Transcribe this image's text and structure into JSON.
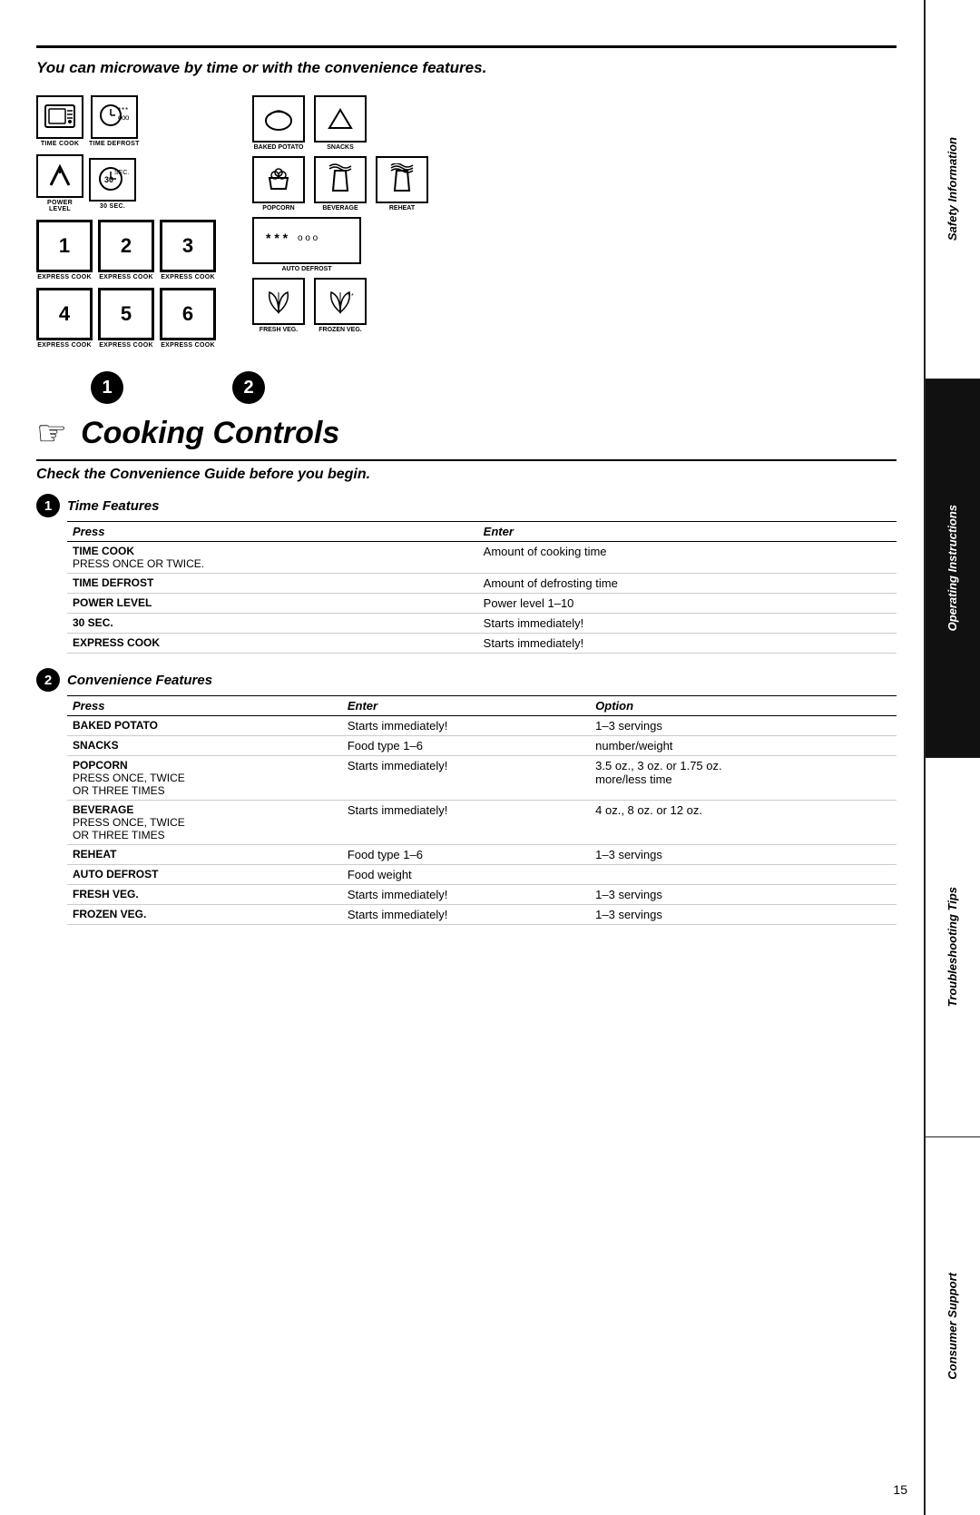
{
  "page": {
    "intro": "You can microwave by time or with the convenience features.",
    "subtitle": "Check the Convenience Guide before you begin.",
    "cooking_controls_title": "Cooking Controls",
    "page_number": "15"
  },
  "sidebar": {
    "sections": [
      {
        "label": "Safety Information",
        "dark": false
      },
      {
        "label": "Operating Instructions",
        "dark": true
      },
      {
        "label": "Troubleshooting Tips",
        "dark": false
      },
      {
        "label": "Consumer Support",
        "dark": false
      }
    ]
  },
  "buttons_left": [
    {
      "icon": "time-cook",
      "label": "TIME COOK"
    },
    {
      "icon": "time-defrost",
      "label": "TIME DEFROST"
    },
    {
      "icon": "power-level",
      "label": "POWER\nLEVEL"
    },
    {
      "icon": "30sec",
      "label": "30 SEC."
    }
  ],
  "express_cook": {
    "label": "EXPRESS COOK",
    "buttons": [
      "1",
      "2",
      "3",
      "4",
      "5",
      "6"
    ]
  },
  "buttons_right": [
    {
      "icon": "baked-potato",
      "label": "BAKED POTATO"
    },
    {
      "icon": "snacks",
      "label": "SNACKS"
    },
    {
      "icon": "popcorn",
      "label": "POPCORN"
    },
    {
      "icon": "beverage",
      "label": "BEVERAGE"
    },
    {
      "icon": "reheat",
      "label": "REHEAT"
    },
    {
      "icon": "auto-defrost",
      "label": "AUTO DEFROST"
    },
    {
      "icon": "fresh-veg",
      "label": "FRESH VEG."
    },
    {
      "icon": "frozen-veg",
      "label": "FROZEN VEG."
    }
  ],
  "time_features": {
    "section_title": "Time Features",
    "section_number": "1",
    "col_press": "Press",
    "col_enter": "Enter",
    "rows": [
      {
        "press": "TIME COOK",
        "press_sub": "Press once or twice.",
        "enter": "Amount of cooking time",
        "option": ""
      },
      {
        "press": "TIME DEFROST",
        "press_sub": "",
        "enter": "Amount of defrosting time",
        "option": ""
      },
      {
        "press": "POWER LEVEL",
        "press_sub": "",
        "enter": "Power level 1–10",
        "option": ""
      },
      {
        "press": "30 SEC.",
        "press_sub": "",
        "enter": "Starts immediately!",
        "option": ""
      },
      {
        "press": "EXPRESS COOK",
        "press_sub": "",
        "enter": "Starts immediately!",
        "option": ""
      }
    ]
  },
  "convenience_features": {
    "section_title": "Convenience Features",
    "section_number": "2",
    "col_press": "Press",
    "col_enter": "Enter",
    "col_option": "Option",
    "rows": [
      {
        "press": "BAKED POTATO",
        "press_sub": "",
        "enter": "Starts immediately!",
        "option": "1–3 servings"
      },
      {
        "press": "SNACKS",
        "press_sub": "",
        "enter": "Food type 1–6",
        "option": "number/weight"
      },
      {
        "press": "POPCORN",
        "press_sub": "Press once, twice\nor three times",
        "enter": "Starts immediately!",
        "option": "3.5 oz., 3 oz. or 1.75 oz.\nmore/less time"
      },
      {
        "press": "BEVERAGE",
        "press_sub": "Press once, twice\nor three times",
        "enter": "Starts immediately!",
        "option": "4 oz., 8 oz. or 12 oz."
      },
      {
        "press": "REHEAT",
        "press_sub": "",
        "enter": "Food type 1–6",
        "option": "1–3 servings"
      },
      {
        "press": "AUTO DEFROST",
        "press_sub": "",
        "enter": "Food weight",
        "option": ""
      },
      {
        "press": "FRESH VEG.",
        "press_sub": "",
        "enter": "Starts immediately!",
        "option": "1–3 servings"
      },
      {
        "press": "FROZEN VEG.",
        "press_sub": "",
        "enter": "Starts immediately!",
        "option": "1–3 servings"
      }
    ]
  }
}
